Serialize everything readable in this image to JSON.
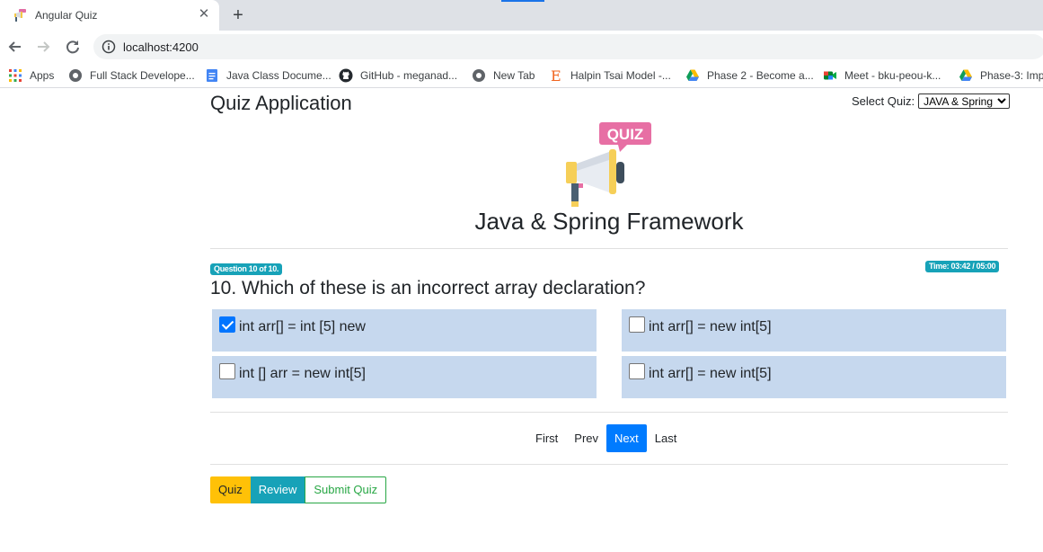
{
  "browser": {
    "tab_title": "Angular Quiz",
    "close_symbol": "✕",
    "new_tab_symbol": "+",
    "url": "localhost:4200",
    "bookmarks": [
      {
        "label": "Apps",
        "icon": "apps-grid-icon"
      },
      {
        "label": "Full Stack Develope...",
        "icon": "globe-icon"
      },
      {
        "label": "Java Class Docume...",
        "icon": "google-docs-icon"
      },
      {
        "label": "GitHub - meganad...",
        "icon": "github-icon"
      },
      {
        "label": "New Tab",
        "icon": "globe-icon"
      },
      {
        "label": "Halpin Tsai Model -...",
        "icon": "etsy-e-icon"
      },
      {
        "label": "Phase 2 - Become a...",
        "icon": "google-drive-icon"
      },
      {
        "label": "Meet - bku-peou-k...",
        "icon": "google-meet-icon"
      },
      {
        "label": "Phase-3: Imp",
        "icon": "google-drive-icon"
      }
    ]
  },
  "page": {
    "title": "Quiz Application",
    "select_label": "Select Quiz:",
    "select_value": "JAVA & Spring",
    "logo_text": "QUIZ",
    "quiz_name": "Java & Spring Framework",
    "question_badge": "Question 10 of 10.",
    "time_badge": "Time: 03:42 / 05:00",
    "question": "10. Which of these is an incorrect array declaration?",
    "options": [
      {
        "text": "int arr[] = int [5] new",
        "checked": true
      },
      {
        "text": "int arr[] = new int[5]",
        "checked": false
      },
      {
        "text": "int [] arr = new int[5]",
        "checked": false
      },
      {
        "text": "int arr[] = new int[5]",
        "checked": false
      }
    ],
    "pager": [
      "First",
      "Prev",
      "Next",
      "Last"
    ],
    "pager_active": "Next",
    "mode_buttons": {
      "quiz": "Quiz",
      "review": "Review",
      "submit": "Submit Quiz"
    }
  },
  "colors": {
    "option_bg": "#c6d8ee",
    "primary": "#007bff",
    "info": "#17a2b8",
    "warning": "#ffc107",
    "success": "#28a745"
  }
}
